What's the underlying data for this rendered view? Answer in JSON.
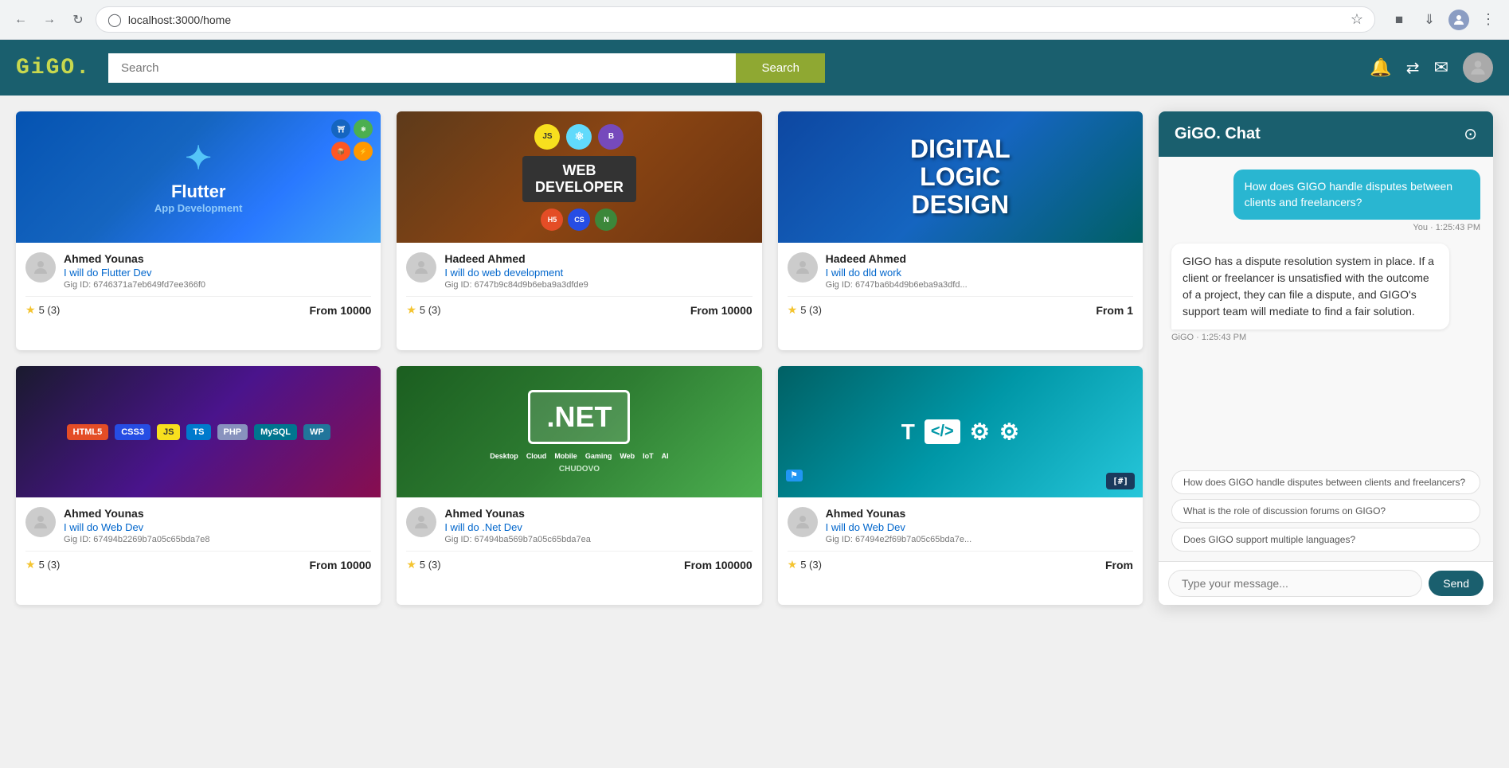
{
  "browser": {
    "url": "localhost:3000/home",
    "back_label": "←",
    "forward_label": "→",
    "refresh_label": "↻"
  },
  "navbar": {
    "logo": "GiGO.",
    "search_placeholder": "Search",
    "search_button_label": "Search",
    "icons": {
      "bell": "🔔",
      "exchange": "⇄",
      "mail": "✉"
    }
  },
  "gigs": [
    {
      "id": 1,
      "user_name": "Ahmed Younas",
      "gig_title": "I will do Flutter Dev",
      "gig_id": "Gig ID: 6746371a7eb649fd7ee366f0",
      "rating": "5",
      "review_count": "(3)",
      "price": "From 10000",
      "image_type": "flutter",
      "image_label": "Flutter\nApp Development"
    },
    {
      "id": 2,
      "user_name": "Hadeed Ahmed",
      "gig_title": "I will do web development",
      "gig_id": "Gig ID: 6747b9c84d9b6eba9a3dfde9",
      "rating": "5",
      "review_count": "(3)",
      "price": "From 10000",
      "image_type": "web",
      "image_label": "WEB DEVELOPER"
    },
    {
      "id": 3,
      "user_name": "Hadeed Ahmed",
      "gig_title": "I will do dld work",
      "gig_id": "Gig ID: 6747ba6b4d9b6eba9a3dfd...",
      "rating": "5",
      "review_count": "(3)",
      "price": "From 1",
      "image_type": "digital",
      "image_label": "DIGITAL\nLOGIC\nDESIGN"
    },
    {
      "id": 4,
      "user_name": "Ahmed Younas",
      "gig_title": "I will do Web Dev",
      "gig_id": "Gig ID: 67494b2269b7a05c65bda7e8",
      "rating": "5",
      "review_count": "(3)",
      "price": "From 10000",
      "image_type": "webdev2",
      "image_label": "Web Dev Stack"
    },
    {
      "id": 5,
      "user_name": "Ahmed Younas",
      "gig_title": "I will do .Net Dev",
      "gig_id": "Gig ID: 67494ba569b7a05c65bda7ea",
      "rating": "5",
      "review_count": "(3)",
      "price": "From 100000",
      "image_type": "net",
      "image_label": ".NET"
    },
    {
      "id": 6,
      "user_name": "Ahmed Younas",
      "gig_title": "I will do Web Dev",
      "gig_id": "Gig ID: 67494e2f69b7a05c65bda7e...",
      "rating": "5",
      "review_count": "(3)",
      "price": "From",
      "image_type": "webdev3",
      "image_label": "Web Dev"
    }
  ],
  "chat": {
    "title": "GiGO. Chat",
    "close_icon": "⊙",
    "messages": [
      {
        "sender": "user",
        "text": "How does GIGO handle disputes between clients and freelancers?",
        "time": "You · 1:25:43 PM",
        "type": "user"
      },
      {
        "sender": "bot",
        "text": "GIGO has a dispute resolution system in place. If a client or freelancer is unsatisfied with the outcome of a project, they can file a dispute, and GIGO's support team will mediate to find a fair solution.",
        "time": "GiGO · 1:25:43 PM",
        "type": "bot"
      }
    ],
    "suggestions": [
      "How does GIGO handle disputes between clients and freelancers?",
      "What is the role of discussion forums on GIGO?",
      "Does GIGO support multiple languages?"
    ],
    "input_placeholder": "Type your message...",
    "send_label": "Send"
  }
}
